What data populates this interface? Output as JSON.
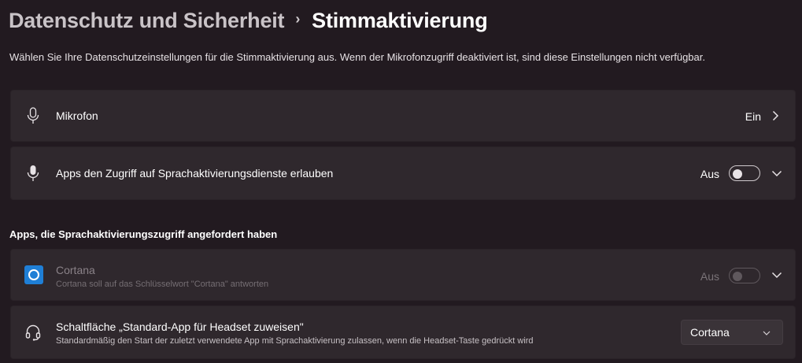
{
  "breadcrumb": {
    "parent": "Datenschutz und Sicherheit",
    "separator": "›",
    "current": "Stimmaktivierung"
  },
  "description": "Wählen Sie Ihre Datenschutzeinstellungen für die Stimmaktivierung aus. Wenn der Mikrofonzugriff deaktiviert ist, sind diese Einstellungen nicht verfügbar.",
  "microphone": {
    "icon": "microphone-icon",
    "title": "Mikrofon",
    "state": "Ein"
  },
  "apps_access": {
    "icon": "microphone-filled-icon",
    "title": "Apps den Zugriff auf Sprachaktivierungsdienste erlauben",
    "state": "Aus",
    "toggle_on": false
  },
  "section_heading": "Apps, die Sprachaktivierungszugriff angefordert haben",
  "cortana": {
    "icon": "cortana-icon",
    "title": "Cortana",
    "subtitle": "Cortana soll auf das Schlüsselwort \"Cortana\" antworten",
    "state": "Aus",
    "toggle_on": false,
    "disabled": true
  },
  "headset": {
    "icon": "headset-icon",
    "title": "Schaltfläche „Standard-App für Headset zuweisen\"",
    "subtitle": "Standardmäßig den Start der zuletzt verwendete App mit Sprachaktivierung zulassen, wenn die Headset-Taste gedrückt wird",
    "selected": "Cortana"
  },
  "colors": {
    "background": "#221a20",
    "card": "#2f282d",
    "cortana_blue": "#1f7fd6"
  }
}
